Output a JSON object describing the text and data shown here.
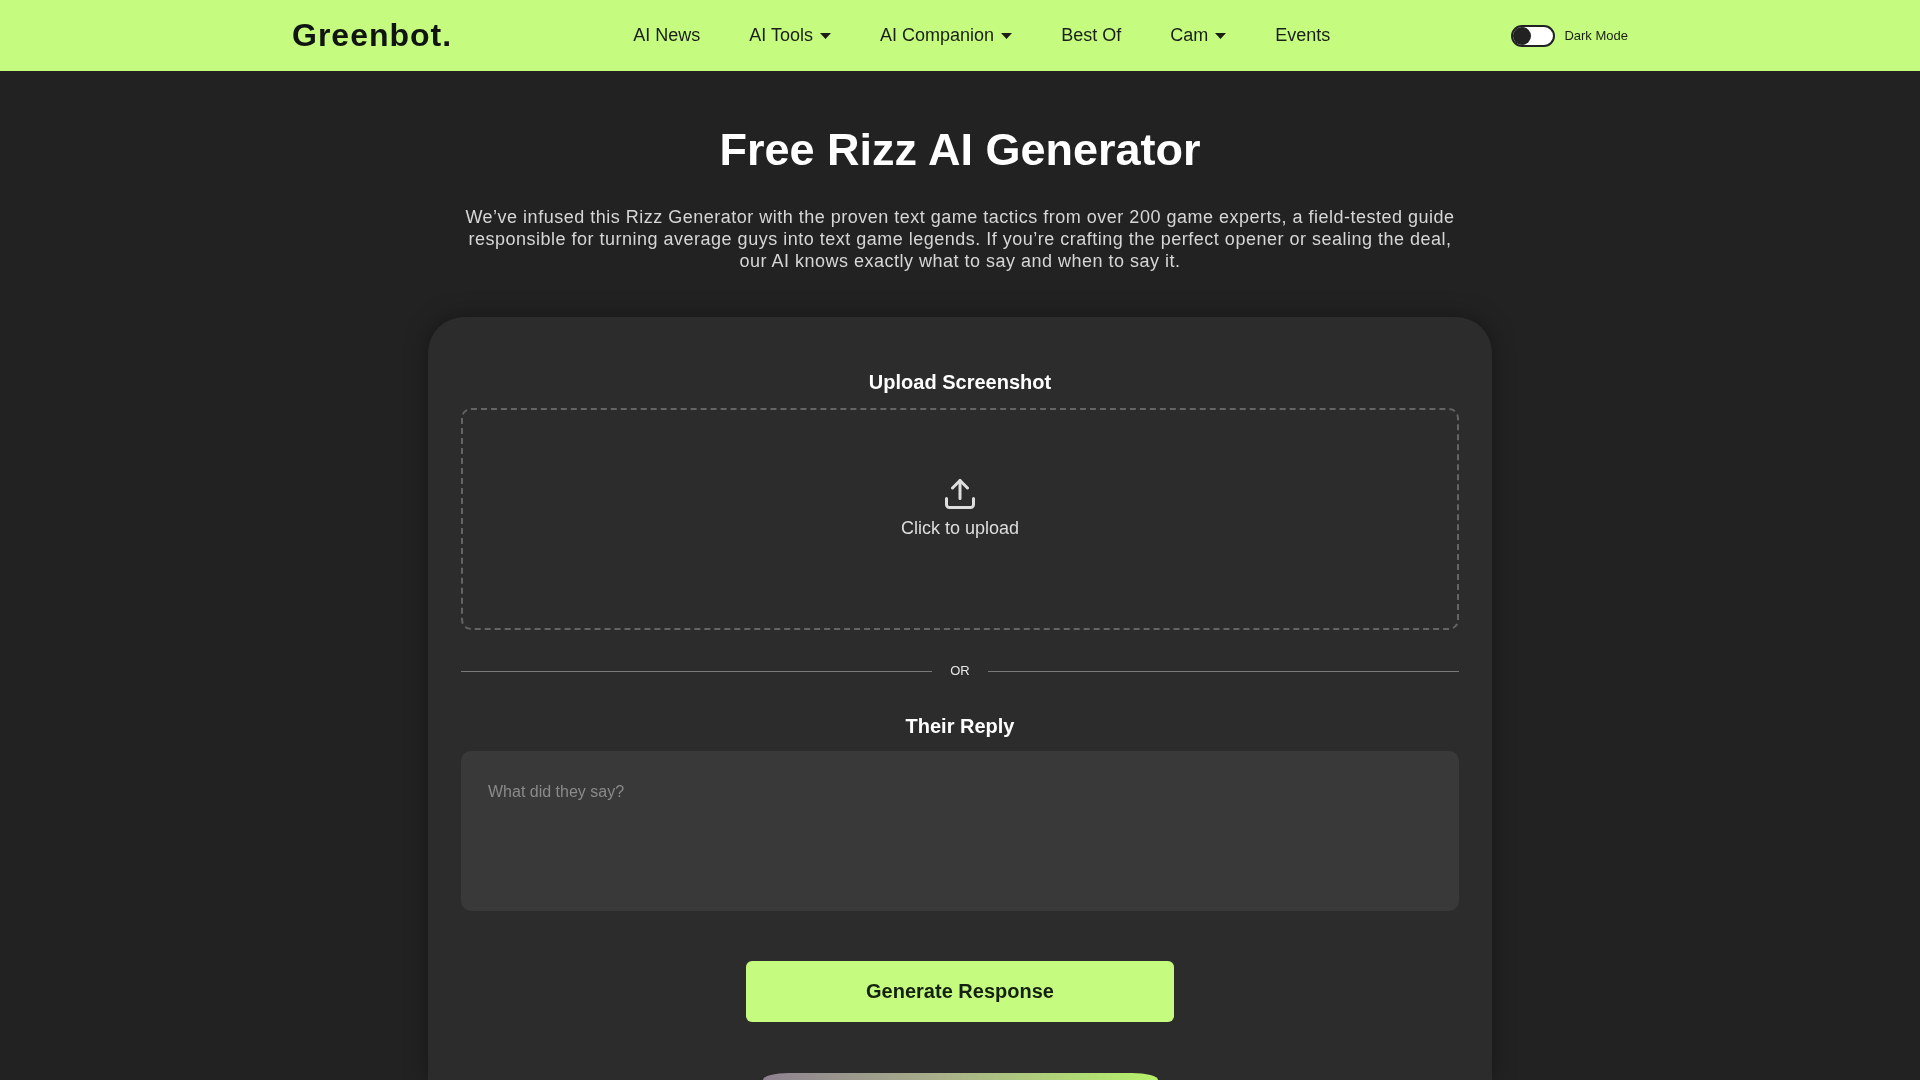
{
  "header": {
    "logo": "Greenbot.",
    "nav": [
      {
        "label": "AI News",
        "has_dropdown": false
      },
      {
        "label": "AI Tools",
        "has_dropdown": true
      },
      {
        "label": "AI Companion",
        "has_dropdown": true
      },
      {
        "label": "Best Of",
        "has_dropdown": false
      },
      {
        "label": "Cam",
        "has_dropdown": true
      },
      {
        "label": "Events",
        "has_dropdown": false
      }
    ],
    "dark_mode_toggle": {
      "label": "Dark Mode",
      "on": false
    }
  },
  "hero": {
    "title": "Free Rizz AI Generator",
    "description": "We’ve infused this Rizz Generator with the proven text game tactics from over 200 game experts, a field-tested guide responsible for turning average guys into text game legends. If you’re crafting the perfect opener or sealing the deal, our AI knows exactly what to say and when to say it."
  },
  "form": {
    "upload": {
      "label": "Upload Screenshot",
      "prompt": "Click to upload"
    },
    "divider": "OR",
    "reply": {
      "label": "Their Reply",
      "placeholder": "What did they say?"
    },
    "submit_button": "Generate Response"
  }
}
